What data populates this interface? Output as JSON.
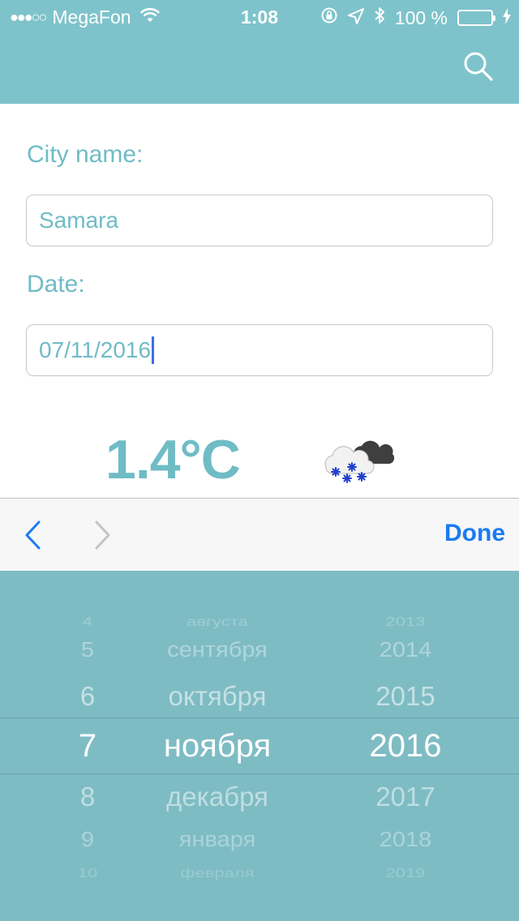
{
  "status_bar": {
    "signal": "●●●○○",
    "carrier": "MegaFon",
    "time": "1:08",
    "battery": "100 %"
  },
  "form": {
    "city_label": "City name:",
    "city_value": "Samara",
    "date_label": "Date:",
    "date_value": "07/11/2016"
  },
  "weather": {
    "temperature": "1.4°C",
    "icon": "snow-cloud-icon"
  },
  "toolbar": {
    "done_label": "Done"
  },
  "picker": {
    "days": [
      "4",
      "5",
      "6",
      "7",
      "8",
      "9",
      "10"
    ],
    "months": [
      "августа",
      "сентября",
      "октября",
      "ноября",
      "декабря",
      "января",
      "февраля"
    ],
    "years": [
      "2013",
      "2014",
      "2015",
      "2016",
      "2017",
      "2018",
      "2019"
    ],
    "selected": {
      "day": "7",
      "month": "ноября",
      "year": "2016"
    }
  },
  "colors": {
    "accent": "#7ec3cb",
    "text_accent": "#6fbcc6",
    "done_blue": "#1a7bf2",
    "picker_bg": "#7ebcc4"
  }
}
